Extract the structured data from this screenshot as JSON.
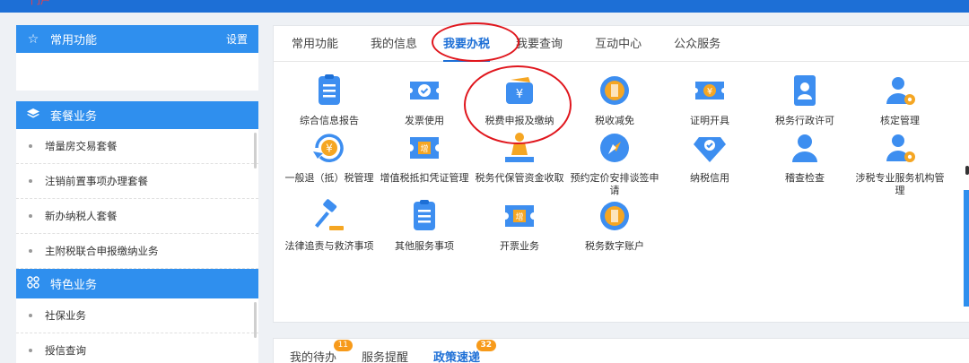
{
  "header": {
    "logo_fragment": "门户"
  },
  "left": {
    "favorites": {
      "title": "常用功能",
      "settings": "设置"
    },
    "package": {
      "title": "套餐业务",
      "items": [
        "增量房交易套餐",
        "注销前置事项办理套餐",
        "新办纳税人套餐",
        "主附税联合申报缴纳业务"
      ]
    },
    "special": {
      "title": "特色业务",
      "items": [
        "社保业务",
        "授信查询"
      ]
    }
  },
  "main": {
    "tabs": [
      "常用功能",
      "我的信息",
      "我要办税",
      "我要查询",
      "互动中心",
      "公众服务"
    ],
    "active_tab": "我要办税",
    "services": [
      {
        "label": "综合信息报告",
        "icon": "clipboard-icon"
      },
      {
        "label": "发票使用",
        "icon": "invoice-check-icon"
      },
      {
        "label": "税费申报及缴纳",
        "icon": "wallet-yuan-icon"
      },
      {
        "label": "税收减免",
        "icon": "coin-icon"
      },
      {
        "label": "证明开具",
        "icon": "yuan-ticket-icon"
      },
      {
        "label": "税务行政许可",
        "icon": "id-card-icon"
      },
      {
        "label": "核定管理",
        "icon": "user-gear-icon"
      },
      {
        "label": "一般退（抵）税管理",
        "icon": "refund-yuan-icon"
      },
      {
        "label": "增值税抵扣凭证管理",
        "icon": "vat-ticket-icon"
      },
      {
        "label": "税务代保管资金收取",
        "icon": "hand-money-icon"
      },
      {
        "label": "预约定价安排谈签申请",
        "icon": "compass-icon"
      },
      {
        "label": "纳税信用",
        "icon": "diamond-check-icon"
      },
      {
        "label": "稽查检查",
        "icon": "user-icon"
      },
      {
        "label": "涉税专业服务机构管理",
        "icon": "user-gear-icon"
      },
      {
        "label": "法律追责与救济事项",
        "icon": "gavel-icon"
      },
      {
        "label": "其他服务事项",
        "icon": "clipboard-icon"
      },
      {
        "label": "开票业务",
        "icon": "vat-ticket-icon"
      },
      {
        "label": "税务数字账户",
        "icon": "coin-icon"
      }
    ]
  },
  "bottom": {
    "tabs": [
      {
        "label": "我的待办",
        "badge": "11"
      },
      {
        "label": "服务提醒",
        "badge": ""
      },
      {
        "label": "政策速递",
        "badge": "32"
      }
    ]
  },
  "colors": {
    "accent": "#1d6fd6",
    "header_blue": "#2f8fee",
    "annotation_red": "#e0161d",
    "badge": "#f79a1a"
  }
}
